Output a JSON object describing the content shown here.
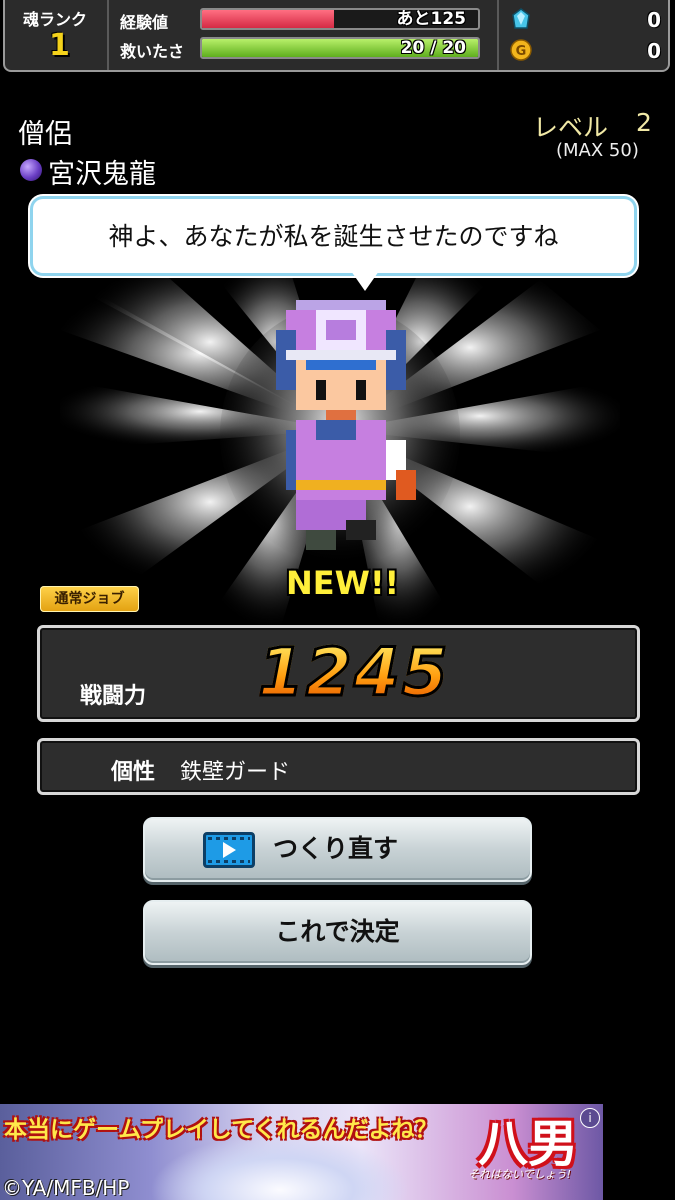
{
  "status_bar": {
    "rank_label": "魂ランク",
    "rank_value": "1",
    "exp_label": "経験値",
    "exp_text": "あと125",
    "exp_fill_fraction": 0.48,
    "saved_label": "救いたさ",
    "saved_text": "20 / 20",
    "saved_fill_fraction": 1.0,
    "gem_icon": "gem-icon",
    "gem_count": "0",
    "gold_icon": "gold-coin-icon",
    "gold_count": "0",
    "colors": {
      "exp_bar": "#e0354f",
      "saved_bar": "#8fd63a",
      "rank": "#f4d21b"
    }
  },
  "character": {
    "job": "僧侶",
    "name": "宮沢鬼龍",
    "level_label": "レベル",
    "level_value": "2",
    "level_max": "(MAX 50)",
    "speech": "神よ、あなたが私を誕生させたのですね",
    "new_badge": "NEW!!",
    "job_tag": "通常ジョブ"
  },
  "stats": {
    "power_label": "戦闘力",
    "power_value": "1245",
    "trait_label": "個性",
    "trait_value": "鉄壁ガード"
  },
  "buttons": {
    "remake_label": "つくり直す",
    "remake_icon": "video-play-icon",
    "decide_label": "これで決定"
  },
  "ad": {
    "headline": "本当にゲームプレイしてくれるんだよね？",
    "logo": "八男",
    "sub": "それはないでしょう!",
    "copyright": "©YA/MFB/HP",
    "info_icon": "info-icon"
  }
}
